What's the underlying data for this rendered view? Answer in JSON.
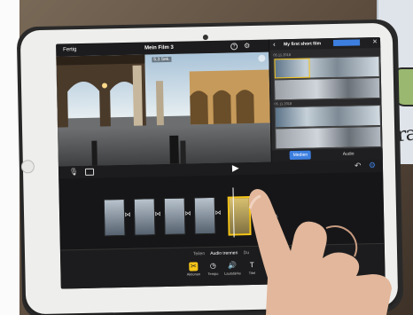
{
  "app": {
    "top_left": "Fertig",
    "project_title": "Mein Film 3",
    "timecode": "5,3 Sek."
  },
  "side_panel": {
    "title": "My first short film",
    "date_1": "05.11.2018",
    "date_2": "05.11.2018",
    "tab_media": "Medien",
    "tab_audio": "Audio"
  },
  "timeline": {
    "selected_clip_duration": "20,0 Sek."
  },
  "bottom": {
    "subtabs": [
      "Teilen",
      "Audio trennen",
      "Du"
    ],
    "tools": [
      {
        "icon": "scissors-icon",
        "label": "Aktionen"
      },
      {
        "icon": "speed-icon",
        "label": "Tempo"
      },
      {
        "icon": "volume-icon",
        "label": "Lautstärke"
      },
      {
        "icon": "text-icon",
        "label": "Titel"
      }
    ]
  },
  "poster_text": "Era",
  "colors": {
    "accent_yellow": "#f5c518",
    "accent_blue": "#3d7fe0",
    "ui_dark": "#1c1c1e"
  }
}
